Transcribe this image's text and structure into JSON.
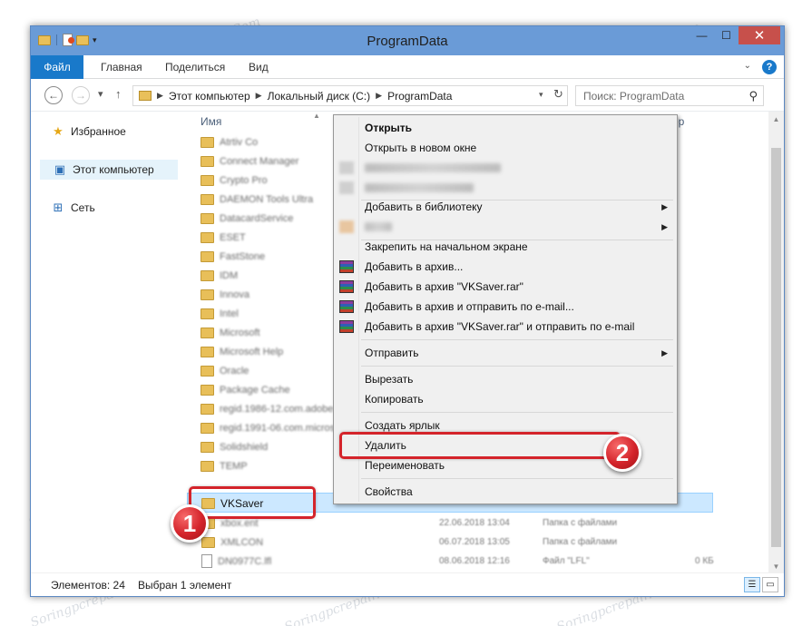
{
  "window": {
    "title": "ProgramData",
    "minimize_glyph": "—",
    "maximize_glyph": "☐",
    "close_glyph": "✕"
  },
  "ribbon": {
    "tabs": [
      "Файл",
      "Главная",
      "Поделиться",
      "Вид"
    ],
    "help_glyph": "?"
  },
  "address": {
    "back_glyph": "←",
    "forward_glyph": "→",
    "up_glyph": "↑",
    "breadcrumbs": [
      "Этот компьютер",
      "Локальный диск (C:)",
      "ProgramData"
    ],
    "search_placeholder": "Поиск: ProgramData"
  },
  "navpane": {
    "items": [
      {
        "label": "Избранное",
        "icon": "star-icon"
      },
      {
        "label": "Этот компьютер",
        "icon": "computer-icon"
      },
      {
        "label": "Сеть",
        "icon": "network-icon"
      }
    ]
  },
  "filelist": {
    "col_name": "Имя",
    "col_size_fragment": "ер",
    "folders": [
      "Atrtiv Co",
      "Connect Manager",
      "Crypto Pro",
      "DAEMON Tools Ultra",
      "DatacardService",
      "ESET",
      "FastStone",
      "IDM",
      "Innova",
      "Intel",
      "Microsoft",
      "Microsoft Help",
      "Oracle",
      "Package Cache",
      "regid.1986-12.com.adobe",
      "regid.1991-06.com.microsoft",
      "Solidshield",
      "TEMP"
    ],
    "selected": "VKSaver",
    "after": [
      {
        "name": "xbox.ent",
        "date": "22.06.2018 13:04",
        "type": "Папка с файлами",
        "size": ""
      },
      {
        "name": "XMLCON",
        "date": "06.07.2018 13:05",
        "type": "Папка с файлами",
        "size": ""
      },
      {
        "name": "DN0977C.lfl",
        "date": "08.06.2018 12:16",
        "type": "Файл \"LFL\"",
        "size": "0 КБ"
      }
    ]
  },
  "status": {
    "count": "Элементов: 24",
    "selected": "Выбран 1 элемент"
  },
  "context_menu": {
    "open": "Открыть",
    "open_new_window": "Открыть в новом окне",
    "add_to_library": "Добавить в библиотеку",
    "pin_start": "Закрепить на начальном экране",
    "add_archive": "Добавить в архив...",
    "add_archive_named": "Добавить в архив \"VKSaver.rar\"",
    "add_archive_email": "Добавить в архив и отправить по e-mail...",
    "add_archive_named_email": "Добавить в архив \"VKSaver.rar\" и отправить по e-mail",
    "send_to": "Отправить",
    "cut": "Вырезать",
    "copy": "Копировать",
    "create_shortcut": "Создать ярлык",
    "delete": "Удалить",
    "rename": "Переименовать",
    "properties": "Свойства"
  },
  "annotations": {
    "step1": "1",
    "step2": "2"
  },
  "watermark": "Soringpcrepair.Com",
  "colors": {
    "file_tab": "#1979ca",
    "window_frame": "#6a9bd7",
    "callout": "#d4242b",
    "selection": "#cce8ff"
  }
}
